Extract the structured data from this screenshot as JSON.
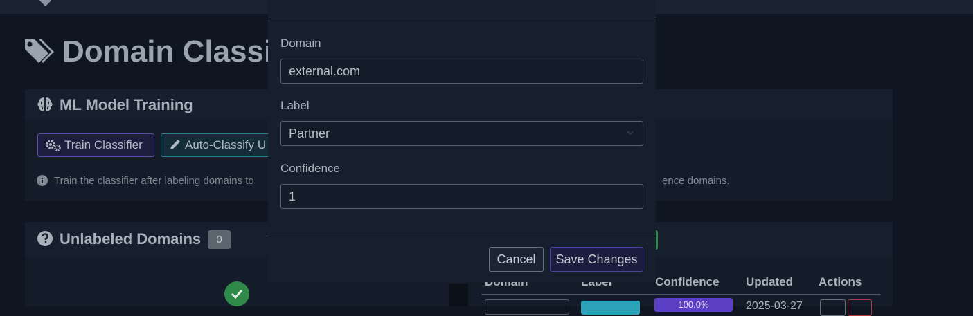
{
  "page": {
    "title": "Domain Classif"
  },
  "ml_card": {
    "title": "ML Model Training",
    "train_button": "Train Classifier",
    "auto_button": "Auto-Classify U",
    "hint_left": "Train the classifier after labeling domains to",
    "hint_right": "ence domains."
  },
  "unlabeled_card": {
    "title": "Unlabeled Domains",
    "count": "0"
  },
  "labeled_table": {
    "columns": [
      "Domain",
      "Label",
      "Confidence",
      "Updated",
      "Actions"
    ],
    "first_row": {
      "confidence": "100.0%",
      "updated": "2025-03-27"
    }
  },
  "modal": {
    "domain_label": "Domain",
    "domain_value": "external.com",
    "label_label": "Label",
    "label_value": "Partner",
    "confidence_label": "Confidence",
    "confidence_value": "1",
    "cancel": "Cancel",
    "save": "Save Changes"
  },
  "colors": {
    "accent_purple": "#5b4fb0",
    "accent_teal": "#2c7f94",
    "success": "#2f8a4a"
  }
}
